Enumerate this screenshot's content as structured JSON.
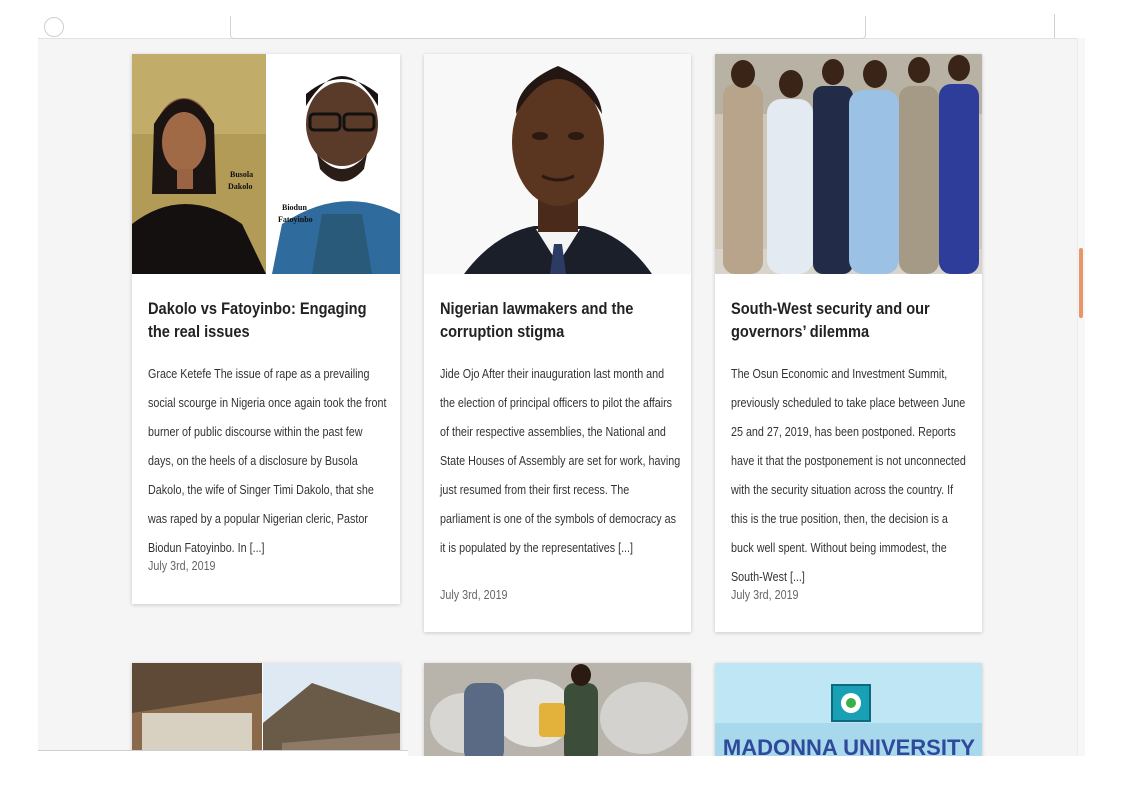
{
  "articles": [
    {
      "title": "Dakolo vs Fatoyinbo: Engaging the real issues",
      "excerpt": "Grace Ketefe The issue of rape as a prevailing social scourge in Nigeria once again took the front burner of public discourse within the past few days, on the heels of a disclosure by Busola Dakolo, the wife of Singer Timi Dakolo, that she was raped by a popular Nigerian cleric, Pastor Biodun Fatoyinbo. In [...]",
      "date": "July 3rd, 2019",
      "image_labels": [
        "Busola",
        "Dakolo",
        "Biodun",
        "Fatoyinbo"
      ]
    },
    {
      "title": "Nigerian lawmakers and the corruption stigma",
      "excerpt": "Jide Ojo After their inauguration last month and the election of principal officers to pilot the affairs of their respective assemblies, the National and State Houses of Assembly are set for work, having just resumed from their first recess. The parliament is one of the symbols of democracy as it is populated by the representatives [...]",
      "date": "July 3rd, 2019"
    },
    {
      "title": "South-West security and our governors’ dilemma",
      "excerpt": "The Osun Economic and Investment Summit, previously scheduled to take place between June 25 and 27, 2019, has been postponed. Reports have it that the postponement is not unconnected with the security situation across the country. If this is the true position, then, the decision is a buck well spent. Without being immodest, the South-West [...]",
      "date": "July 3rd, 2019"
    }
  ],
  "second_row": {
    "third_image_text": "MADONNA UNIVERSITY"
  },
  "colors": {
    "scroll_accent": "#e8956a",
    "page_bg": "#f5f5f5"
  }
}
